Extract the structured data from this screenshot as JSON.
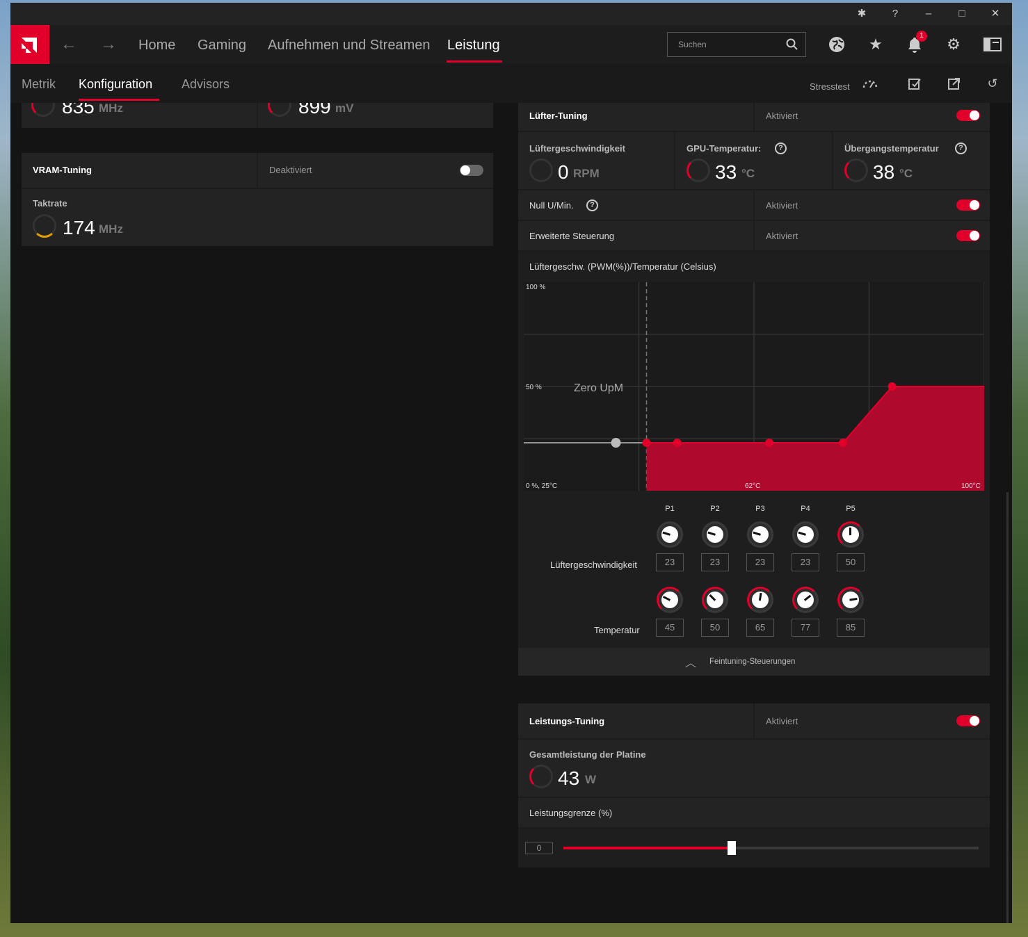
{
  "titlebar": {
    "icons": [
      "bug-icon",
      "help-icon",
      "minimize-icon",
      "maximize-icon",
      "close-icon"
    ]
  },
  "nav": {
    "tabs": [
      {
        "label": "Home"
      },
      {
        "label": "Gaming"
      },
      {
        "label": "Aufnehmen und Streamen"
      },
      {
        "label": "Leistung"
      }
    ],
    "active": "Leistung",
    "search_placeholder": "Suchen",
    "notification_count": "1"
  },
  "subnav": {
    "tabs": [
      {
        "label": "Metrik"
      },
      {
        "label": "Konfiguration"
      },
      {
        "label": "Advisors"
      }
    ],
    "active": "Konfiguration",
    "stresstest_label": "Stresstest"
  },
  "left": {
    "top_values": [
      {
        "value": "835",
        "unit": "MHz"
      },
      {
        "value": "899",
        "unit": "mV"
      }
    ],
    "vram": {
      "title": "VRAM-Tuning",
      "status": "Deaktiviert",
      "enabled": false,
      "clock_label": "Taktrate",
      "clock_value": "174",
      "clock_unit": "MHz"
    }
  },
  "fan": {
    "title": "Lüfter-Tuning",
    "status": "Aktiviert",
    "enabled": true,
    "speed_label": "Lüftergeschwindigkeit",
    "speed_value": "0",
    "speed_unit": "RPM",
    "gpu_temp_label": "GPU-Temperatur:",
    "gpu_temp_value": "33",
    "gpu_temp_unit": "°C",
    "junction_label": "Übergangstemperatur",
    "junction_value": "38",
    "junction_unit": "°C",
    "zero_rpm_label": "Null U/Min.",
    "zero_rpm_status": "Aktiviert",
    "advanced_label": "Erweiterte Steuerung",
    "advanced_status": "Aktiviert",
    "curve_title": "Lüftergeschw. (PWM(%))/Temperatur (Celsius)",
    "points": [
      "P1",
      "P2",
      "P3",
      "P4",
      "P5"
    ],
    "row_speed_label": "Lüftergeschwindigkeit",
    "row_temp_label": "Temperatur",
    "speed_values": [
      "23",
      "23",
      "23",
      "23",
      "50"
    ],
    "temp_values": [
      "45",
      "50",
      "65",
      "77",
      "85"
    ],
    "fine_tuning_label": "Feintuning-Steuerungen"
  },
  "chart_data": {
    "type": "area",
    "labels": {
      "y_top": "100 %",
      "y_mid": "50 %",
      "origin": "0 %, 25°C",
      "x_mid": "62°C",
      "x_max": "100°C",
      "zero_rpm": "Zero UpM"
    },
    "x": [
      45,
      50,
      65,
      77,
      85
    ],
    "y": [
      23,
      23,
      23,
      23,
      50
    ],
    "xlim": [
      25,
      100
    ],
    "ylim": [
      0,
      100
    ],
    "series_color": "#e0002a"
  },
  "power": {
    "title": "Leistungs-Tuning",
    "status": "Aktiviert",
    "enabled": true,
    "board_label": "Gesamtleistung der Platine",
    "board_value": "43",
    "board_unit": "W",
    "limit_label": "Leistungsgrenze (%)",
    "limit_value": "0",
    "slider_level": 0.405
  },
  "colors": {
    "accent": "#e0002a",
    "bg": "#141414",
    "panel": "#232323"
  }
}
